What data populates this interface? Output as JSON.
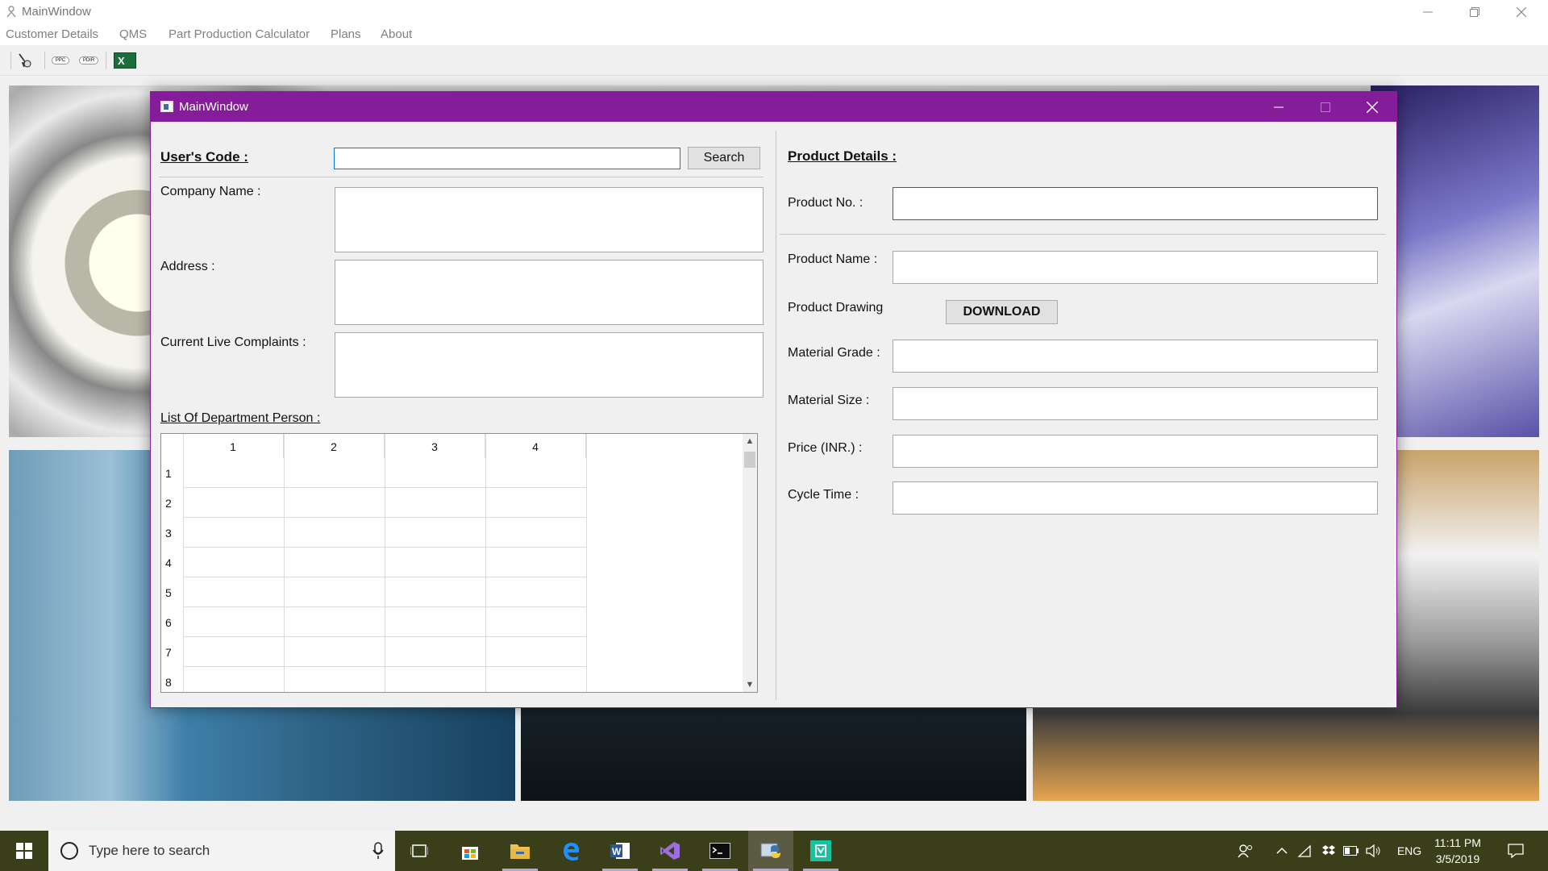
{
  "main_window": {
    "title": "MainWindow",
    "menu": [
      "Customer Details",
      "QMS",
      "Part Production Calculator",
      "Plans",
      "About"
    ],
    "toolbar": {
      "btn1_icon": "cursor-tool-icon",
      "btn2_label": "PPC",
      "btn3_label": "PDIR",
      "btn4_icon": "excel-icon",
      "btn4_label": "X"
    }
  },
  "dialog": {
    "title": "MainWindow",
    "left": {
      "users_code_label": "User's Code :",
      "users_code_value": "",
      "search_button": "Search",
      "company_name_label": "Company Name :",
      "address_label": "Address :",
      "complaints_label": "Current Live Complaints :",
      "dept_list_label": "List Of Department Person :",
      "table": {
        "columns": [
          "1",
          "2",
          "3",
          "4"
        ],
        "rows": [
          "1",
          "2",
          "3",
          "4",
          "5",
          "6",
          "7",
          "8"
        ]
      }
    },
    "right": {
      "heading": "Product Details :",
      "product_no_label": "Product No. :",
      "product_name_label": "Product Name :",
      "product_drawing_label": "Product Drawing",
      "download_button": "DOWNLOAD",
      "material_grade_label": "Material Grade :",
      "material_size_label": "Material Size :",
      "price_label": "Price (INR.) :",
      "cycle_time_label": "Cycle Time :"
    }
  },
  "taskbar": {
    "search_placeholder": "Type here to search",
    "apps": [
      "task-view-icon",
      "store-icon",
      "file-explorer-icon",
      "edge-icon",
      "word-icon",
      "visual-studio-icon",
      "terminal-icon",
      "python-icon",
      "app-icon"
    ],
    "tray_language": "ENG",
    "time": "11:11 PM",
    "date": "3/5/2019"
  },
  "colors": {
    "dialog_titlebar": "#851c99",
    "taskbar": "#3a3e19"
  }
}
